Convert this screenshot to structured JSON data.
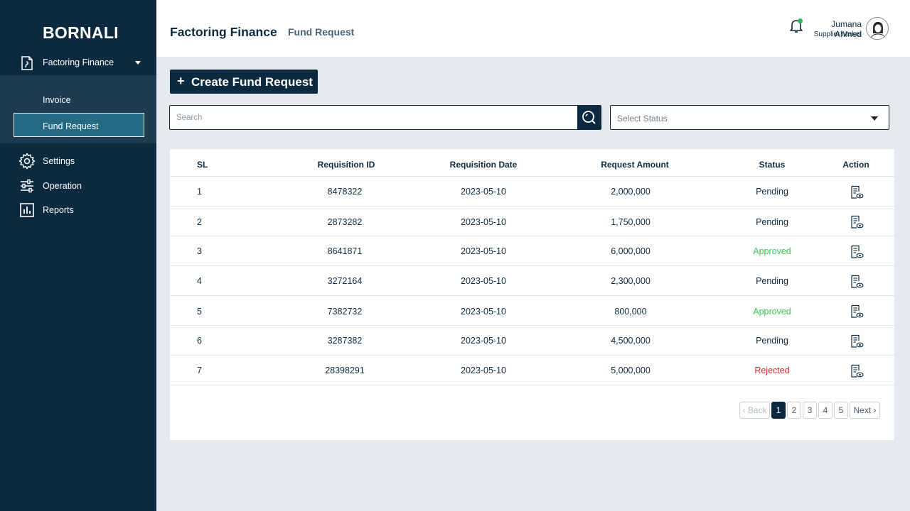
{
  "sidebar": {
    "brand": "BORNALI",
    "main_item": "Factoring Finance",
    "sub_items": [
      "Invoice",
      "Fund Request"
    ],
    "items": [
      "Settings",
      "Operation",
      "Reports"
    ]
  },
  "header": {
    "title": "Factoring Finance",
    "subtitle": "Fund Request",
    "user_name": "Jumana Ahmed",
    "user_role": "Supplier Maker"
  },
  "toolbar": {
    "create_plus": "+",
    "create_label": "Create Fund Request",
    "search_placeholder": "Search",
    "status_placeholder": "Select Status"
  },
  "table": {
    "columns": [
      "SL",
      "Requisition ID",
      "Requisition Date",
      "Request Amount",
      "Status",
      "Action"
    ],
    "rows": [
      {
        "sl": "1",
        "id": "8478322",
        "date": "2023-05-10",
        "amount": "2,000,000",
        "status": "Pending"
      },
      {
        "sl": "2",
        "id": "2873282",
        "date": "2023-05-10",
        "amount": "1,750,000",
        "status": "Pending"
      },
      {
        "sl": "3",
        "id": "8641871",
        "date": "2023-05-10",
        "amount": "6,000,000",
        "status": "Approved"
      },
      {
        "sl": "4",
        "id": "3272164",
        "date": "2023-05-10",
        "amount": "2,300,000",
        "status": "Pending"
      },
      {
        "sl": "5",
        "id": "7382732",
        "date": "2023-05-10",
        "amount": "800,000",
        "status": "Approved"
      },
      {
        "sl": "6",
        "id": "3287382",
        "date": "2023-05-10",
        "amount": "4,500,000",
        "status": "Pending"
      },
      {
        "sl": "7",
        "id": "28398291",
        "date": "2023-05-10",
        "amount": "5,000,000",
        "status": "Rejected"
      }
    ]
  },
  "pagination": {
    "back": "Back",
    "next": "Next",
    "pages": [
      "1",
      "2",
      "3",
      "4",
      "5"
    ],
    "current": "1"
  },
  "colors": {
    "sidebar_bg": "#0b2a40",
    "active_item": "#256a85",
    "approved": "#3cc94b",
    "rejected": "#e5242c",
    "notification": "#2eb356"
  },
  "icons": {
    "nav_main": "document-icon",
    "settings": "gear-icon",
    "operation": "sliders-icon",
    "reports": "bar-chart-icon",
    "bell": "bell-icon",
    "search": "search-icon",
    "action": "view-document-icon"
  }
}
